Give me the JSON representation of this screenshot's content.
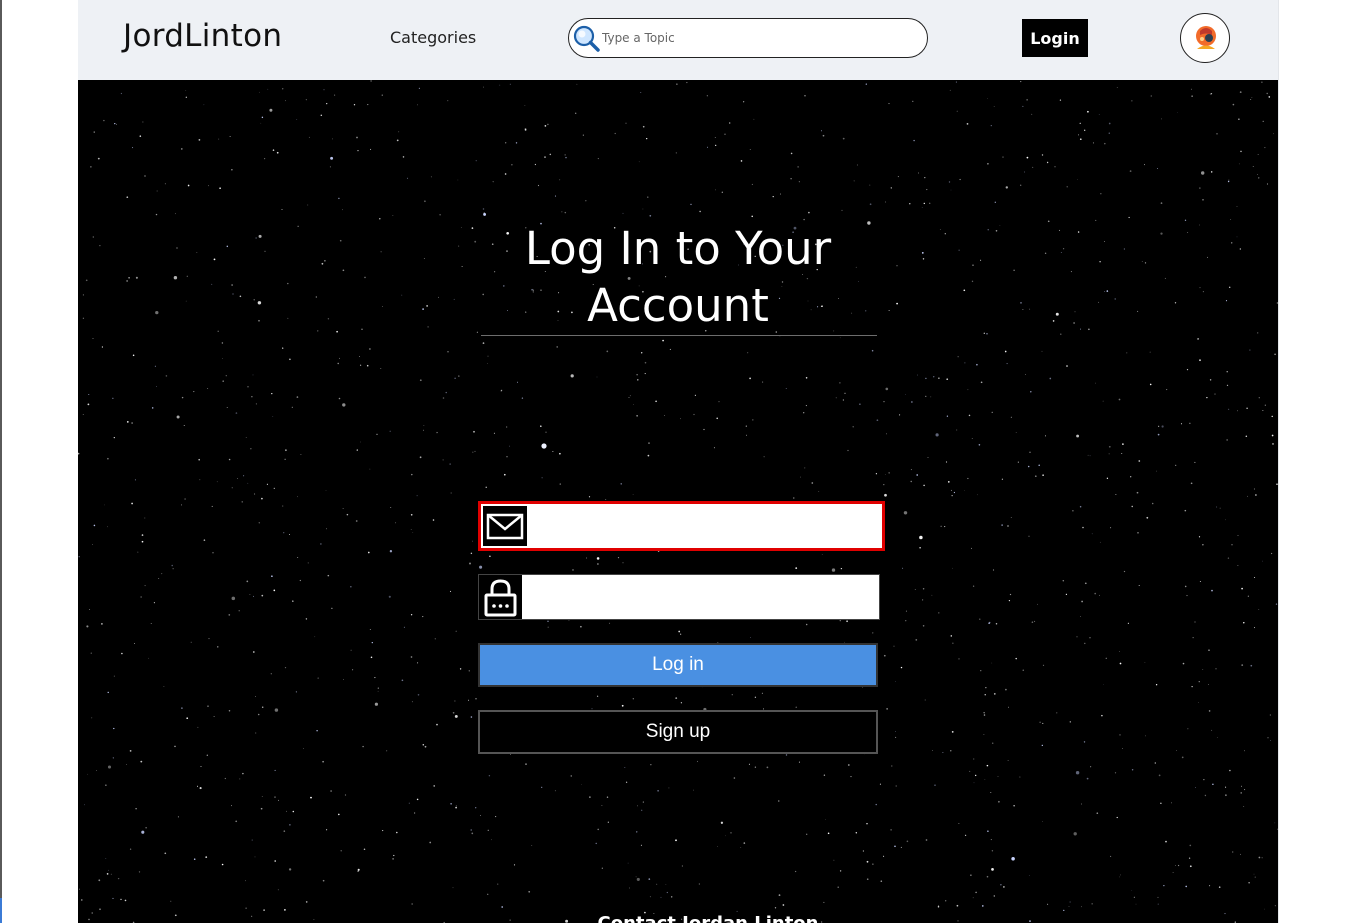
{
  "navbar": {
    "brand": "JordLinton",
    "categories_label": "Categories",
    "search": {
      "placeholder": "Type a Topic",
      "value": "",
      "icon": "search-icon"
    },
    "login_label": "Login",
    "avatar_icon": "user-avatar-icon"
  },
  "main": {
    "title_line1": "Log In to Your",
    "title_line2": "Account",
    "email_field": {
      "icon": "envelope-icon",
      "value": "",
      "highlight_color": "#e00000"
    },
    "password_field": {
      "icon": "lock-icon",
      "value": ""
    },
    "login_button": "Log in",
    "signup_button": "Sign up",
    "footer_partial": "Contact Jordan Linton"
  },
  "colors": {
    "navbar_bg": "#eef1f5",
    "hero_bg": "#000000",
    "login_button_bg": "#4a90e2",
    "signup_button_bg": "#000000"
  }
}
